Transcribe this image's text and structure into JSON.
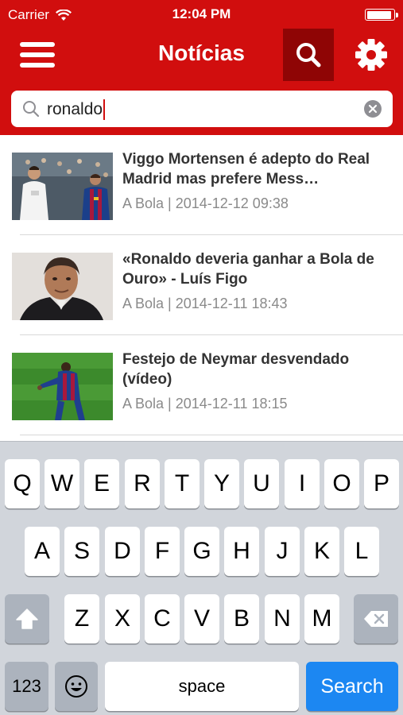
{
  "status_bar": {
    "carrier": "Carrier",
    "time": "12:04 PM",
    "battery_level": 0.95
  },
  "navbar": {
    "title": "Notícias",
    "menu_icon": "hamburger-menu-icon",
    "search_icon": "search-icon",
    "settings_icon": "gear-icon"
  },
  "search": {
    "query": "ronaldo",
    "search_icon": "magnifier-icon",
    "clear_icon": "clear-icon"
  },
  "articles": [
    {
      "headline": "Viggo Mortensen é adepto do Real Madrid mas prefere Mess…",
      "source": "A Bola",
      "date": "2014-12-12 09:38"
    },
    {
      "headline": "«Ronaldo deveria ganhar a Bola de Ouro» - Luís Figo",
      "source": "A Bola",
      "date": "2014-12-11 18:43"
    },
    {
      "headline": "Festejo de Neymar desvendado (vídeo)",
      "source": "A Bola",
      "date": "2014-12-11 18:15"
    }
  ],
  "keyboard": {
    "row1": [
      "Q",
      "W",
      "E",
      "R",
      "T",
      "Y",
      "U",
      "I",
      "O",
      "P"
    ],
    "row2": [
      "A",
      "S",
      "D",
      "F",
      "G",
      "H",
      "J",
      "K",
      "L"
    ],
    "row3": [
      "Z",
      "X",
      "C",
      "V",
      "B",
      "N",
      "M"
    ],
    "numbers_label": "123",
    "space_label": "space",
    "return_label": "Search",
    "shift_icon": "shift-arrow-icon",
    "delete_icon": "backspace-icon",
    "emoji_icon": "emoji-icon"
  },
  "colors": {
    "brand": "#d10e0e",
    "brand_dark": "#8f0505",
    "keyboard_bg": "#d1d5db",
    "action_blue": "#1c87f2",
    "meta_gray": "#8a8a8a"
  }
}
